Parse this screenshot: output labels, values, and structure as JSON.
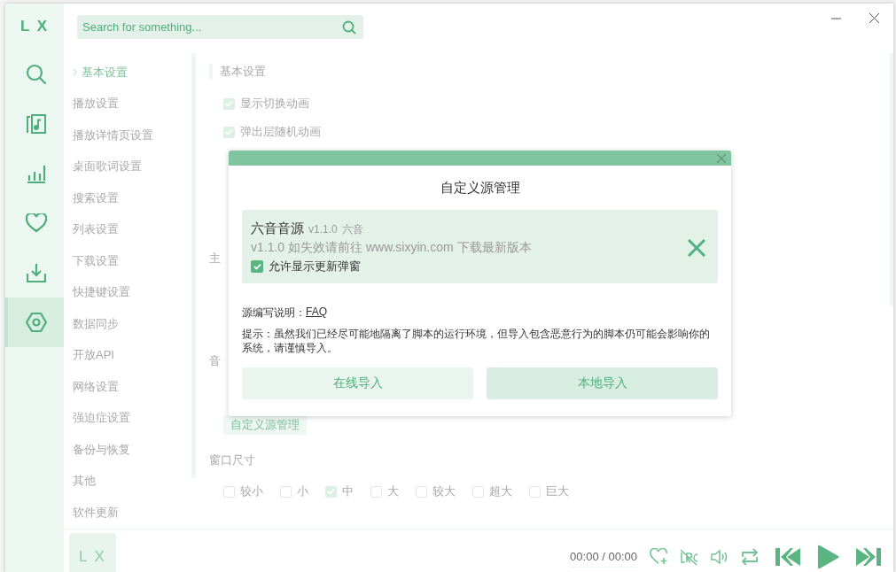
{
  "app": {
    "logo": "L X",
    "search": {
      "placeholder": "Search for something..."
    }
  },
  "sidebar": {
    "items": [
      {
        "kind": "search",
        "selected": false
      },
      {
        "kind": "music",
        "selected": false
      },
      {
        "kind": "chart",
        "selected": false
      },
      {
        "kind": "heart",
        "selected": false
      },
      {
        "kind": "download",
        "selected": false
      },
      {
        "kind": "settings",
        "selected": true
      }
    ]
  },
  "settings_nav": {
    "items": [
      {
        "label": "基本设置",
        "selected": true
      },
      {
        "label": "播放设置",
        "selected": false
      },
      {
        "label": "播放详情页设置",
        "selected": false
      },
      {
        "label": "桌面歌词设置",
        "selected": false
      },
      {
        "label": "搜索设置",
        "selected": false
      },
      {
        "label": "列表设置",
        "selected": false
      },
      {
        "label": "下载设置",
        "selected": false
      },
      {
        "label": "快捷键设置",
        "selected": false
      },
      {
        "label": "数据同步",
        "selected": false
      },
      {
        "label": "开放API",
        "selected": false
      },
      {
        "label": "网络设置",
        "selected": false
      },
      {
        "label": "强迫症设置",
        "selected": false
      },
      {
        "label": "备份与恢复",
        "selected": false
      },
      {
        "label": "其他",
        "selected": false
      },
      {
        "label": "软件更新",
        "selected": false
      }
    ]
  },
  "content": {
    "section_title": "基本设置",
    "options": [
      {
        "label": "显示切换动画",
        "checked": true
      },
      {
        "label": "弹出层随机动画",
        "checked": true
      }
    ],
    "theme_heading": "主",
    "music_heading": "音",
    "custom_source_button": "自定义源管理",
    "window_size": {
      "title": "窗口尺寸",
      "options": [
        {
          "label": "较小",
          "selected": false
        },
        {
          "label": "小",
          "selected": false
        },
        {
          "label": "中",
          "selected": true
        },
        {
          "label": "大",
          "selected": false
        },
        {
          "label": "较大",
          "selected": false
        },
        {
          "label": "超大",
          "selected": false
        },
        {
          "label": "巨大",
          "selected": false
        }
      ]
    }
  },
  "dialog": {
    "title": "自定义源管理",
    "sources": [
      {
        "name": "六音音源",
        "version": "v1.1.0",
        "author": "六音",
        "description": "v1.1.0 如失效请前往 www.sixyin.com 下载最新版本",
        "allow_update_popup": {
          "label": "允许显示更新弹窗",
          "checked": true
        }
      }
    ],
    "doc_label": "源编写说明：",
    "doc_link": "FAQ",
    "warning": "提示：虽然我们已经尽可能地隔离了脚本的运行环境，但导入包含恶意行为的脚本仍可能会影响你的系统，请谨慎导入。",
    "buttons": [
      {
        "label": "在线导入",
        "kind": "online"
      },
      {
        "label": "本地导入",
        "kind": "local"
      }
    ]
  },
  "player": {
    "logo": "L X",
    "time": "00:00 / 00:00"
  }
}
